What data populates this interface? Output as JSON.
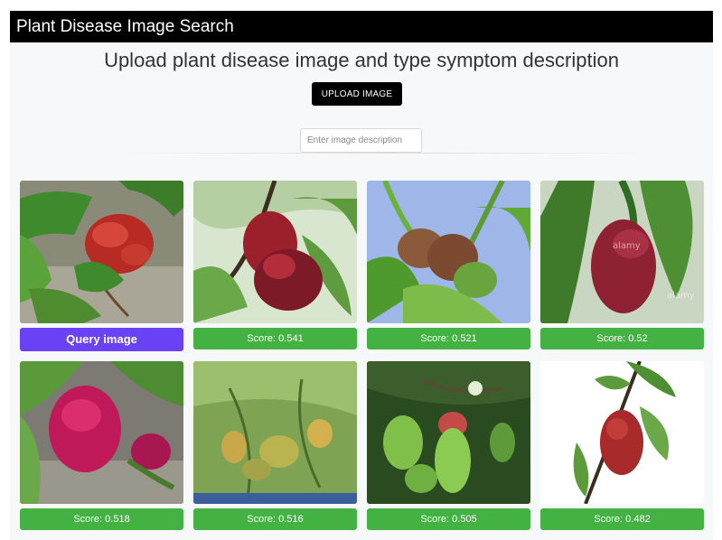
{
  "app": {
    "title": "Plant Disease Image Search",
    "headline": "Upload plant disease image and type symptom description",
    "upload_label": "UPLOAD IMAGE",
    "description_placeholder": "Enter image description",
    "description_value": ""
  },
  "results": [
    {
      "label": "Query image",
      "kind": "query",
      "image": "red-puckered-peach-leaf-on-rock"
    },
    {
      "label": "Score: 0.541",
      "kind": "result",
      "image": "red-curled-leaf-on-branch"
    },
    {
      "label": "Score: 0.521",
      "kind": "result",
      "image": "curled-leaves-sky-background"
    },
    {
      "label": "Score: 0.52",
      "kind": "result",
      "image": "red-leaf-alamy-watermark"
    },
    {
      "label": "Score: 0.518",
      "kind": "result",
      "image": "pink-curled-leaves-on-wood"
    },
    {
      "label": "Score: 0.516",
      "kind": "result",
      "image": "yellow-green-curled-shoots"
    },
    {
      "label": "Score: 0.505",
      "kind": "result",
      "image": "green-curled-leaves-dark-bg"
    },
    {
      "label": "Score: 0.482",
      "kind": "result",
      "image": "red-leaf-white-background"
    }
  ],
  "colors": {
    "titlebar": "#000000",
    "query_button": "#6a42f5",
    "score_badge": "#44b243"
  }
}
